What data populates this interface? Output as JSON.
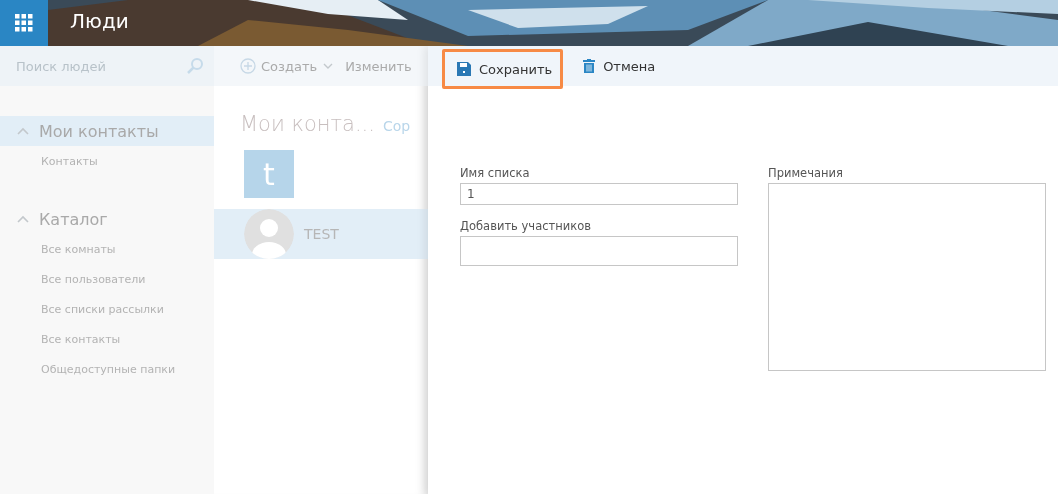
{
  "app": {
    "title": "Люди"
  },
  "search": {
    "placeholder": "Поиск людей"
  },
  "nav": [
    {
      "label": "Мои контакты",
      "expanded": true,
      "selected": true,
      "children": [
        {
          "label": "Контакты",
          "selected": false
        }
      ]
    },
    {
      "label": "Каталог",
      "expanded": true,
      "selected": false,
      "children": [
        {
          "label": "Все комнаты",
          "selected": false
        },
        {
          "label": "Все пользователи",
          "selected": false
        },
        {
          "label": "Все списки рассылки",
          "selected": false
        },
        {
          "label": "Все контакты",
          "selected": false
        },
        {
          "label": "Общедоступные папки",
          "selected": false
        }
      ]
    }
  ],
  "list_toolbar": {
    "create": "Создать",
    "edit": "Изменить"
  },
  "list": {
    "title": "Мои конта...",
    "link": "Сор",
    "tile": "t",
    "contacts": [
      {
        "name": "TEST",
        "selected": true
      }
    ]
  },
  "editor": {
    "actions": [
      {
        "kind": "save",
        "label": "Сохранить",
        "highlighted": true
      },
      {
        "kind": "cancel",
        "label": "Отмена",
        "highlighted": false
      }
    ],
    "fields": [
      {
        "label": "Имя списка",
        "value": "1"
      },
      {
        "label": "Добавить участников"
      }
    ],
    "notes": {
      "label": "Примечания"
    }
  }
}
